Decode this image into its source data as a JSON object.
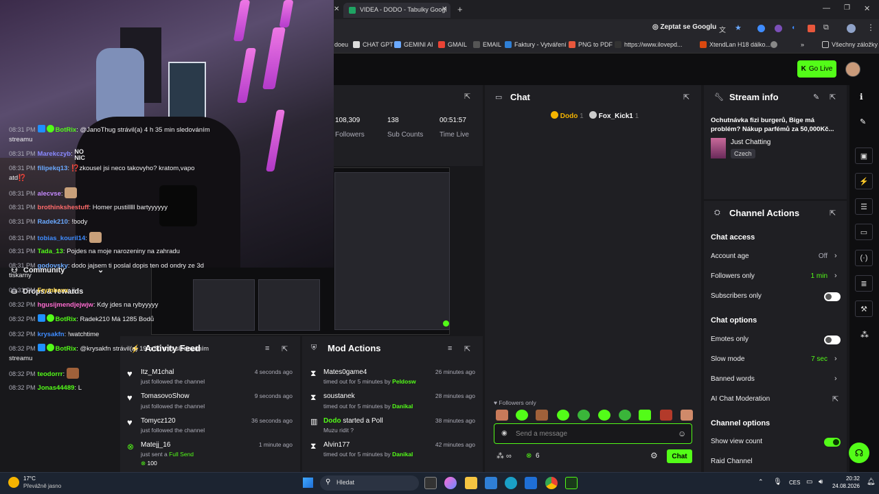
{
  "browser": {
    "tab_title": "VIDEA - DODO - Tabulky Googl",
    "ask_google": "Zeptat se Googlu",
    "bookmarks": [
      "doeu",
      "CHAT GPT",
      "GEMINI AI",
      "GMAIL",
      "EMAIL",
      "Faktury - Vytváření",
      "PNG to PDF",
      "https://www.ilovepd...",
      "XtendLan H18 dálko...",
      "Všechny záložky"
    ]
  },
  "header": {
    "go_live": "Go Live"
  },
  "sidebar": {
    "items": [
      {
        "label": "Community",
        "icon": "people-icon"
      },
      {
        "label": "Drops & rewards",
        "icon": "gift-icon"
      }
    ]
  },
  "stats": {
    "followers_value": "108,309",
    "followers_label": "Followers",
    "subs_value": "138",
    "subs_label": "Sub Counts",
    "time_value": "00:51:57",
    "time_label": "Time Live"
  },
  "activity_feed": {
    "title": "Activity Feed",
    "items": [
      {
        "name": "Itz_M1chal",
        "sub": "just followed the channel",
        "time": "4 seconds ago"
      },
      {
        "name": "TomasovoShow",
        "sub": "just followed the channel",
        "time": "9 seconds ago"
      },
      {
        "name": "Tomycz120",
        "sub": "just followed the channel",
        "time": "36 seconds ago"
      },
      {
        "name": "Matejj_16",
        "sub_prefix": "just sent a ",
        "sub_highlight": "Full Send",
        "amount": "100",
        "time": "1 minute ago"
      }
    ]
  },
  "mod_actions": {
    "title": "Mod Actions",
    "items": [
      {
        "name": "Mates0game4",
        "sub": "timed out for 5 minutes by ",
        "by": "Peldosw",
        "time": "26 minutes ago"
      },
      {
        "name": "soustanek",
        "sub": "timed out for 5 minutes by ",
        "by": "Danikal",
        "time": "28 minutes ago"
      },
      {
        "name": "Dodo",
        "name_rest": " started a Poll",
        "sub": "Muzu ridit ?",
        "time": "38 minutes ago"
      },
      {
        "name": "Alvin177",
        "sub": "timed out for 5 minutes by ",
        "by": "Danikal",
        "time": "42 minutes ago"
      }
    ]
  },
  "chat": {
    "title": "Chat",
    "pinned": [
      {
        "name": "Dodo",
        "count": "1"
      },
      {
        "name": "Fox_Kick1",
        "count": "1"
      }
    ],
    "messages": [
      {
        "time": "08:31 PM",
        "user": "BotRix",
        "color": "#53fc18",
        "text": "@JanoThug strávil(a) 4 h 35 min sledováním streamu"
      },
      {
        "time": "08:31 PM",
        "user": "Marekczyb",
        "color": "#8a8aff",
        "text": "",
        "emote_text": "NO NIC"
      },
      {
        "time": "08:31 PM",
        "user": "filipekq13",
        "color": "#6aa9ff",
        "text": "⁉️zkousel jsi neco takovyho? kratom,vapo atd⁉️"
      },
      {
        "time": "08:31 PM",
        "user": "alecvse",
        "color": "#c58aff",
        "text": ""
      },
      {
        "time": "08:31 PM",
        "user": "brothinkshestuff",
        "color": "#ff6b6b",
        "text": "Homer pustilllll bartyyyyyy"
      },
      {
        "time": "08:31 PM",
        "user": "Radek210",
        "color": "#6aa9ff",
        "text": "!body"
      },
      {
        "time": "08:31 PM",
        "user": "tobias_kouril14",
        "color": "#3f8cff",
        "text": ""
      },
      {
        "time": "08:31 PM",
        "user": "Tada_13",
        "color": "#53fc18",
        "text": "Pojdes na moje narozeniny na zahradu"
      },
      {
        "time": "08:31 PM",
        "user": "godovsky",
        "color": "#6aa9ff",
        "text": "dodo jajsem ti poslal dopis ten od ondry ze 3d tiskarny"
      },
      {
        "time": "08:31 PM",
        "user": "Frymbexx",
        "color": "#ffd84a",
        "text": "jj"
      },
      {
        "time": "08:32 PM",
        "user": "hgusijmendjejwjw",
        "color": "#ff6bd0",
        "text": "Kdy jdes na rybyyyyy"
      },
      {
        "time": "08:32 PM",
        "user": "BotRix",
        "color": "#53fc18",
        "text": "Radek210 Má 1285 Bodů"
      },
      {
        "time": "08:32 PM",
        "user": "krysakfn",
        "color": "#3f8cff",
        "text": "!watchtime"
      },
      {
        "time": "08:32 PM",
        "user": "BotRix",
        "color": "#53fc18",
        "text": "@krysakfn strávil(a) 19 h 50 min sledováním streamu"
      },
      {
        "time": "08:32 PM",
        "user": "teodorrr",
        "color": "#53fc18",
        "text": ""
      },
      {
        "time": "08:32 PM",
        "user": "Jonas44489",
        "color": "#53fc18",
        "text": "L"
      }
    ],
    "followers_only": "Followers only",
    "placeholder": "Send a message",
    "points": "6",
    "send_label": "Chat"
  },
  "stream_info": {
    "title": "Stream info",
    "stream_title": "Ochutnávka fizi burgerů, Bige má problém? Nákup parfémů za 50,000Kč...",
    "category": "Just Chatting",
    "tag": "Czech"
  },
  "channel_actions": {
    "title": "Channel Actions",
    "chat_access": "Chat access",
    "account_age": "Account age",
    "account_age_val": "Off",
    "followers_only": "Followers only",
    "followers_only_val": "1 min",
    "subscribers_only": "Subscribers only",
    "chat_options": "Chat options",
    "emotes_only": "Emotes only",
    "slow_mode": "Slow mode",
    "slow_mode_val": "7 sec",
    "banned_words": "Banned words",
    "ai_mod": "AI Chat Moderation",
    "channel_options": "Channel options",
    "show_view_count": "Show view count",
    "raid_channel": "Raid Channel"
  },
  "taskbar": {
    "weather_temp": "17°C",
    "weather_desc": "Převážně jasno",
    "search": "Hledat",
    "lang": "CES",
    "time": "20:32",
    "date": "24.08.2026"
  },
  "colors": {
    "accent": "#53fc18",
    "panel": "#1f1f23",
    "bg": "#0e0e10"
  }
}
